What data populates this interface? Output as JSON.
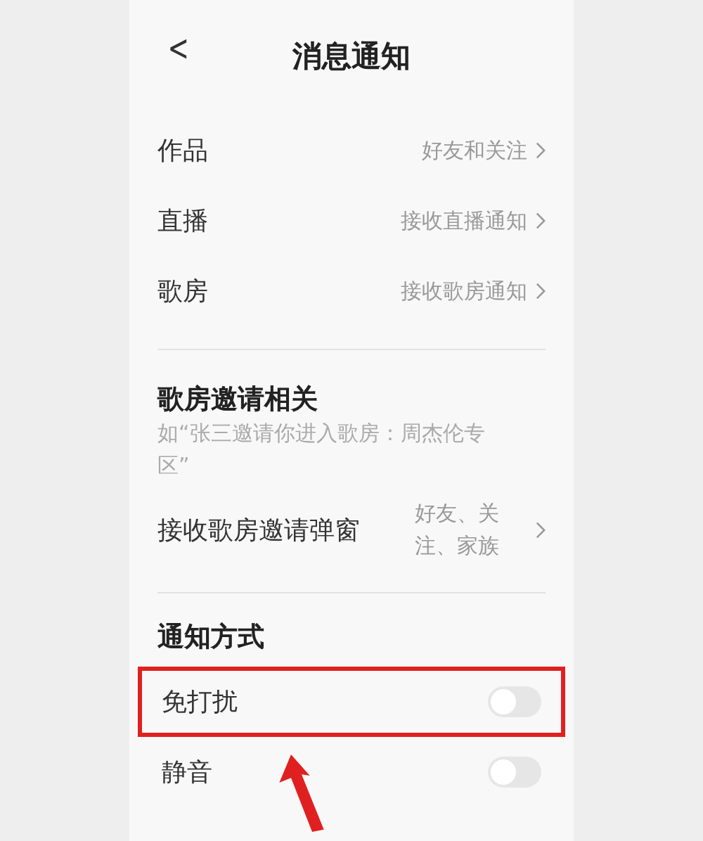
{
  "header": {
    "back": "<",
    "title": "消息通知"
  },
  "rows": [
    {
      "label": "作品",
      "value": "好友和关注"
    },
    {
      "label": "直播",
      "value": "接收直播通知"
    },
    {
      "label": "歌房",
      "value": "接收歌房通知"
    }
  ],
  "invite_section": {
    "heading": "歌房邀请相关",
    "description": "如“张三邀请你进入歌房：周杰伦专区”",
    "row": {
      "label": "接收歌房邀请弹窗",
      "value": "好友、关注、家族"
    }
  },
  "notify_section": {
    "heading": "通知方式",
    "toggles": [
      {
        "label": "免打扰",
        "on": false,
        "highlighted": true
      },
      {
        "label": "静音",
        "on": false,
        "highlighted": false
      }
    ]
  }
}
